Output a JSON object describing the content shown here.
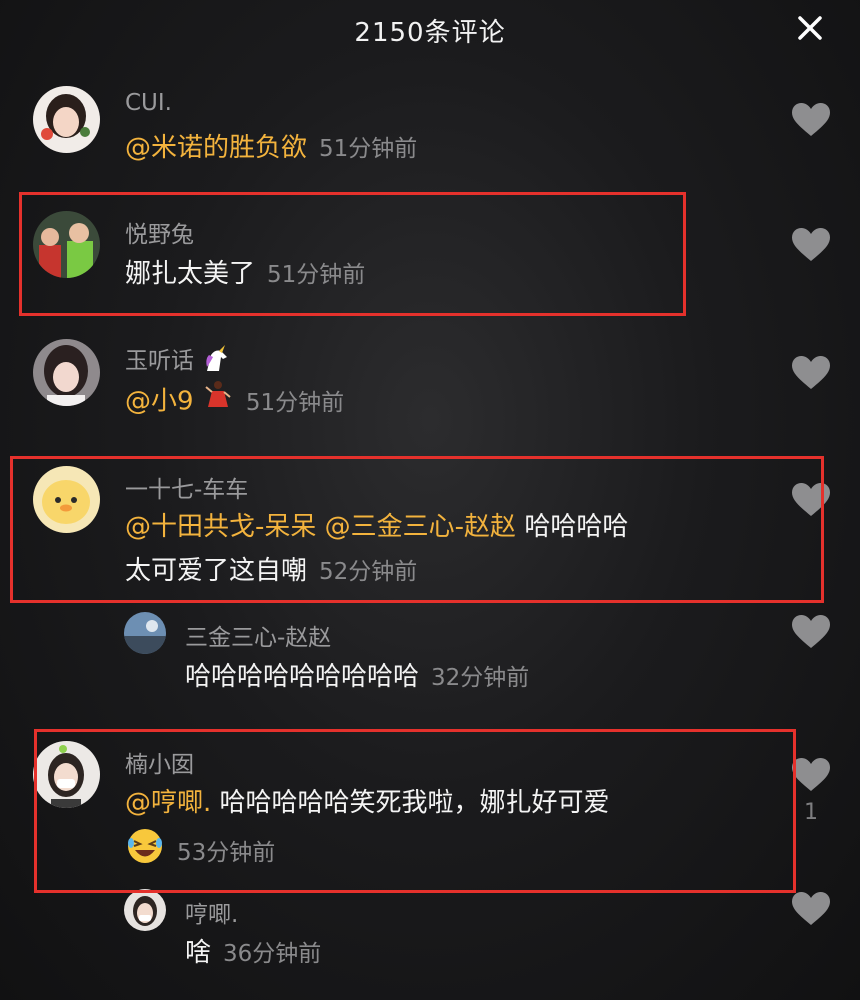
{
  "header": {
    "title": "2150条评论",
    "close_icon": "close-icon"
  },
  "comments": [
    {
      "author": "CUI.",
      "mention": "@米诺的胜负欲",
      "text": "",
      "time": "51分钟前"
    },
    {
      "author": "悦野兔",
      "mention": "",
      "text": "娜扎太美了",
      "time": "51分钟前"
    },
    {
      "author": "玉听话",
      "author_emoji": "unicorn-icon",
      "mention": "@小9",
      "mention_emoji": "dancer-icon",
      "text": "",
      "time": "51分钟前"
    },
    {
      "author": "一十七-车车",
      "mention1": "@十田共戈-呆呆",
      "mention2": "@三金三心-赵赵",
      "text_line1": "哈哈哈哈",
      "text_line2": "太可爱了这自嘲",
      "time": "52分钟前"
    },
    {
      "author": "三金三心-赵赵",
      "text": "哈哈哈哈哈哈哈哈哈",
      "time": "32分钟前",
      "reply": true
    },
    {
      "author": "楠小囡",
      "mention": "@哼唧.",
      "text": "哈哈哈哈哈笑死我啦，娜扎好可爱",
      "emoji": "laughing-face-icon",
      "time": "53分钟前",
      "likes": "1"
    },
    {
      "author": "哼唧.",
      "text": "啥",
      "time": "36分钟前",
      "reply": true
    }
  ],
  "colors": {
    "mention": "#f3b33d",
    "highlight_box": "#e5312c",
    "background": "#1b1b1d"
  }
}
